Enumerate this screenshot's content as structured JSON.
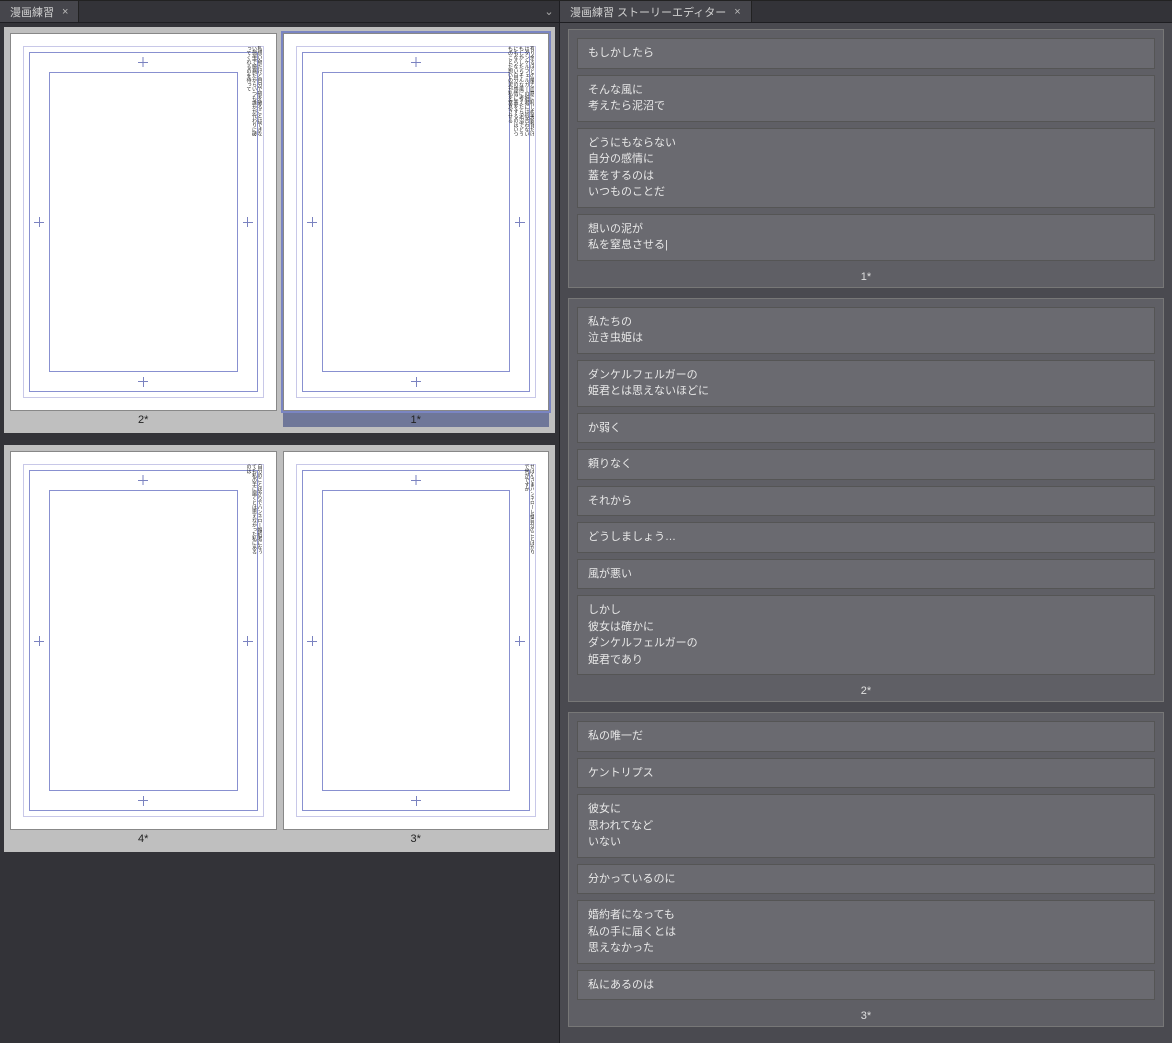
{
  "tabs": {
    "left": {
      "title": "漫画練習",
      "close": "×",
      "dropdown_icon": "⌄"
    },
    "right": {
      "title": "漫画練習 ストーリーエディター",
      "close": "×"
    }
  },
  "pages": [
    {
      "id": 2,
      "label": "2*",
      "selected": false
    },
    {
      "id": 1,
      "label": "1*",
      "selected": true
    },
    {
      "id": 4,
      "label": "4*",
      "selected": false
    },
    {
      "id": 3,
      "label": "3*",
      "selected": false
    }
  ],
  "page_text_preview": {
    "1": "有り余るほどの魔力血筋に恥じぬ美貌背だけはダンケルフェルガーの姫君には似合わないもしかしたらそんな風に考えたら泥沼でどうにもならない自分の感情に蓋をするのはいつものことだ想いの泥が私を窒息させる",
    "2": "私想い卵だけど自分で殻を破ることはできない弱虫で臆病だからいつも誰かが代わりに破ってくれるのを待って",
    "3": "せばんさまハンネローレ様自分のことばかりで何がですか",
    "4": "自分のことばかりでハンネロー婚約者になっても私の手に届くとは思えなかった私にあるのは"
  },
  "story_blocks": [
    {
      "label": "1*",
      "texts": [
        "もしかしたら",
        "そんな風に\n考えたら泥沼で",
        "どうにもならない\n自分の感情に\n蓋をするのは\nいつものことだ",
        "想いの泥が\n私を窒息させる|"
      ]
    },
    {
      "label": "2*",
      "texts": [
        "私たちの\n泣き虫姫は",
        "ダンケルフェルガーの\n姫君とは思えないほどに",
        "か弱く",
        "頼りなく",
        "それから",
        "どうしましょう…",
        "風が悪い",
        "しかし\n彼女は確かに\nダンケルフェルガーの\n姫君であり"
      ]
    },
    {
      "label": "3*",
      "texts": [
        "私の唯一だ",
        "ケントリプス",
        "彼女に\n思われてなど\nいない",
        "分かっているのに",
        "婚約者になっても\n私の手に届くとは\n思えなかった",
        "私にあるのは"
      ]
    }
  ]
}
